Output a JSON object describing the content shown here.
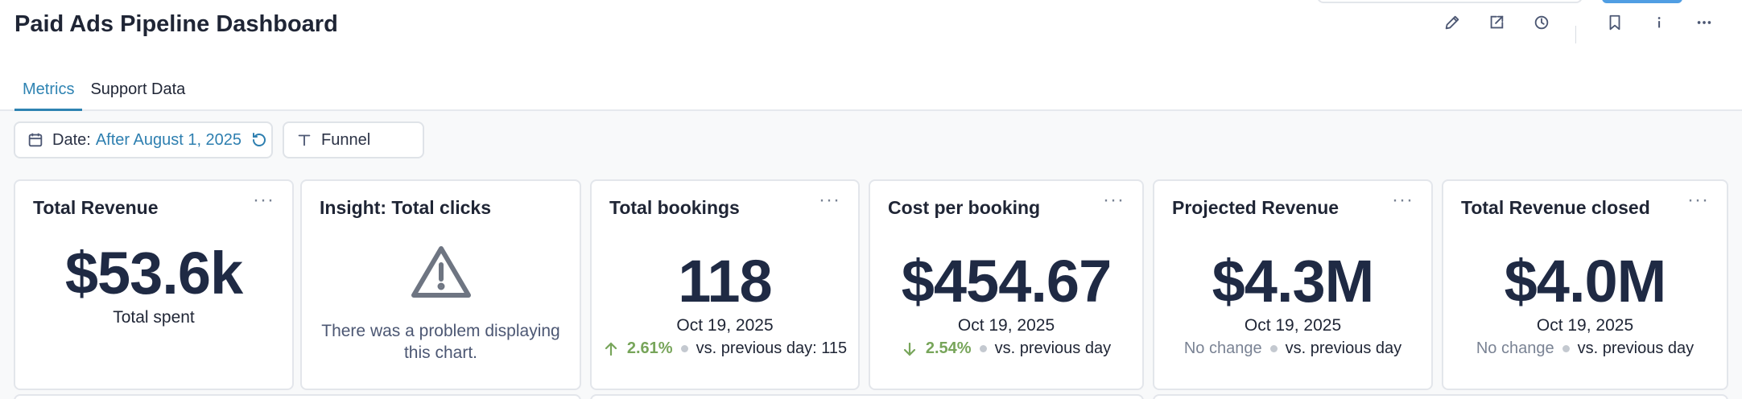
{
  "header": {
    "title": "Paid Ads Pipeline Dashboard"
  },
  "actions": [
    {
      "icon": "pencil-icon"
    },
    {
      "icon": "share-icon"
    },
    {
      "icon": "clock-icon"
    },
    {
      "icon": "bookmark-icon"
    },
    {
      "icon": "info-icon"
    },
    {
      "icon": "more-icon"
    }
  ],
  "tabs": [
    {
      "label": "Metrics",
      "active": true
    },
    {
      "label": "Support Data",
      "active": false
    }
  ],
  "filters": {
    "date": {
      "label": "Date:",
      "value": "After August 1, 2025"
    },
    "funnel": {
      "label": "Funnel"
    }
  },
  "cards": [
    {
      "title": "Total Revenue",
      "menu": "···",
      "value": "$53.6k",
      "caption": "Total spent"
    },
    {
      "title": "Insight: Total clicks",
      "error": "There was a problem displaying this chart."
    },
    {
      "title": "Total bookings",
      "menu": "···",
      "value": "118",
      "date": "Oct 19, 2025",
      "change": "2.61%",
      "direction": "up",
      "comparison": "vs. previous day: 115"
    },
    {
      "title": "Cost per booking",
      "menu": "···",
      "value": "$454.67",
      "date": "Oct 19, 2025",
      "change": "2.54%",
      "direction": "down",
      "comparison": "vs. previous day"
    },
    {
      "title": "Projected Revenue",
      "menu": "···",
      "value": "$4.3M",
      "date": "Oct 19, 2025",
      "change": "No change",
      "comparison": "vs. previous day"
    },
    {
      "title": "Total Revenue closed",
      "menu": "···",
      "value": "$4.0M",
      "date": "Oct 19, 2025",
      "change": "No change",
      "comparison": "vs. previous day"
    }
  ],
  "colors": {
    "accent": "#2e83b2",
    "positive": "#77a55a",
    "primary_button": "#509ee3"
  }
}
